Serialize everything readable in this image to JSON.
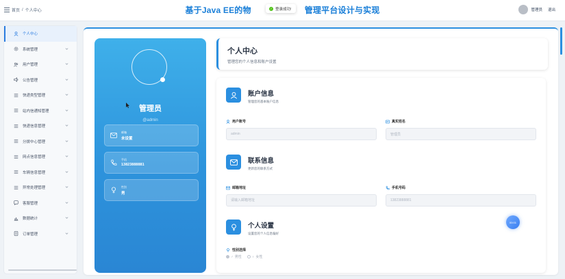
{
  "header": {
    "breadcrumb_home": "首页",
    "breadcrumb_sep": "/",
    "breadcrumb_current": "个人中心",
    "site_title_left": "基于Java EE的物",
    "site_title_right": "管理平台设计与实现",
    "toast": "登录成功!",
    "user_name": "管理员",
    "logout": "退出"
  },
  "sidebar": {
    "items": [
      {
        "label": "个人中心",
        "icon": "user-icon"
      },
      {
        "label": "系统管理",
        "icon": "gear-icon"
      },
      {
        "label": "用户管理",
        "icon": "users-icon"
      },
      {
        "label": "公告管理",
        "icon": "speaker-icon"
      },
      {
        "label": "快递类型管理",
        "icon": "list-icon"
      },
      {
        "label": "站内信通知管理",
        "icon": "list-icon"
      },
      {
        "label": "快递信息管理",
        "icon": "list-icon"
      },
      {
        "label": "分拨中心管理",
        "icon": "list-icon"
      },
      {
        "label": "网点信息管理",
        "icon": "list-icon"
      },
      {
        "label": "车辆信息管理",
        "icon": "list-icon"
      },
      {
        "label": "异常处理管理",
        "icon": "list-icon"
      },
      {
        "label": "客服管理",
        "icon": "chat-icon"
      },
      {
        "label": "数据统计",
        "icon": "chart-icon"
      },
      {
        "label": "订单管理",
        "icon": "order-icon"
      }
    ]
  },
  "profile": {
    "name": "管理员",
    "username": "@admin",
    "email_label": "邮箱",
    "email_value": "未设置",
    "phone_label": "手机",
    "phone_value": "13823888881",
    "gender_label": "性别",
    "gender_value": "男"
  },
  "page": {
    "title": "个人中心",
    "subtitle": "管理您的个人信息和账户设置"
  },
  "account": {
    "title": "账户信息",
    "subtitle": "管理您的基本账户信息",
    "account_label": "用户账号",
    "account_value": "admin",
    "realname_label": "真实姓名",
    "realname_value": "管理员"
  },
  "contact": {
    "title": "联系信息",
    "subtitle": "更新您的联系方式",
    "email_label": "邮箱地址",
    "email_placeholder": "请输入邮箱地址",
    "phone_label": "手机号码",
    "phone_value": "13823888881"
  },
  "personal": {
    "title": "个人设置",
    "subtitle": "设置您的个人信息偏好",
    "gender_label": "性别选择",
    "male": "男性",
    "female": "女性"
  },
  "float_btn": "00:01",
  "colors": {
    "accent": "#2b8fe0",
    "title": "#1a7fd8",
    "success": "#52c41a"
  }
}
